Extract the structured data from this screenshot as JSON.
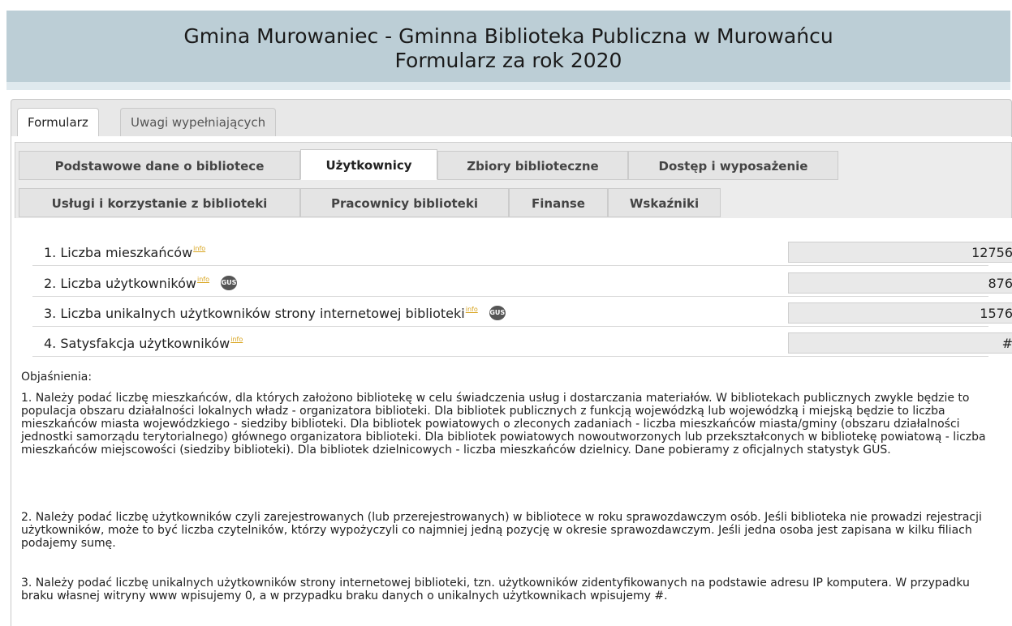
{
  "header": {
    "title_line1": "Gmina Murowaniec - Gminna Biblioteka Publiczna w Murowańcu",
    "title_line2": "Formularz za rok 2020"
  },
  "outer_tabs": [
    {
      "label": "Formularz",
      "active": true
    },
    {
      "label": "Uwagi wypełniających",
      "active": false
    }
  ],
  "inner_tabs_row1": [
    {
      "label": "Podstawowe dane o bibliotece",
      "active": false
    },
    {
      "label": "Użytkownicy",
      "active": true
    },
    {
      "label": "Zbiory biblioteczne",
      "active": false
    },
    {
      "label": "Dostęp i wyposażenie",
      "active": false
    }
  ],
  "inner_tabs_row2": [
    {
      "label": "Usługi i korzystanie z biblioteki",
      "active": false
    },
    {
      "label": "Pracownicy biblioteki",
      "active": false
    },
    {
      "label": "Finanse",
      "active": false
    },
    {
      "label": "Wskaźniki",
      "active": false
    }
  ],
  "info_marker": "info",
  "gus_badge": "GUS",
  "fields": [
    {
      "label": "1. Liczba mieszkańców",
      "value": "12756",
      "gus": false
    },
    {
      "label": "2. Liczba użytkowników",
      "value": "876",
      "gus": true
    },
    {
      "label": "3. Liczba unikalnych użytkowników strony internetowej biblioteki",
      "value": "1576",
      "gus": true
    },
    {
      "label": "4. Satysfakcja użytkowników",
      "value": "#",
      "gus": false
    }
  ],
  "notes": {
    "heading": "Objaśnienia:",
    "items": [
      "1. Należy podać liczbę mieszkańców, dla których założono bibliotekę w celu świadczenia usług i dostarczania materiałów. W bibliotekach publicznych zwykle będzie to populacja obszaru działalności lokalnych władz - organizatora biblioteki. Dla bibliotek publicznych z funkcją wojewódzką lub wojewódzką i miejską będzie to liczba mieszkańców miasta wojewódzkiego - siedziby biblioteki. Dla bibliotek powiatowych o zleconych zadaniach - liczba mieszkańców miasta/gminy (obszaru działalności jednostki samorządu terytorialnego) głównego organizatora biblioteki. Dla bibliotek powiatowych nowoutworzonych lub przekształconych w bibliotekę powiatową - liczba mieszkańców miejscowości (siedziby biblioteki). Dla bibliotek dzielnicowych - liczba mieszkańców dzielnicy. Dane pobieramy z oficjalnych statystyk GUS.",
      "2. Należy podać liczbę użytkowników czyli zarejestrowanych (lub przerejestrowanych) w bibliotece w roku sprawozdawczym osób. Jeśli biblioteka nie prowadzi rejestracji użytkowników, może to być liczba czytelników, którzy wypożyczyli co najmniej jedną pozycję w okresie sprawozdawczym. Jeśli jedna osoba jest zapisana w kilku filiach podajemy sumę.",
      "3. Należy podać liczbę unikalnych użytkowników strony internetowej biblioteki, tzn. użytkowników zidentyfikowanych na podstawie adresu IP komputera. W przypadku braku własnej witryny www wpisujemy 0, a w przypadku braku danych o unikalnych użytkownikach wpisujemy #."
    ]
  }
}
